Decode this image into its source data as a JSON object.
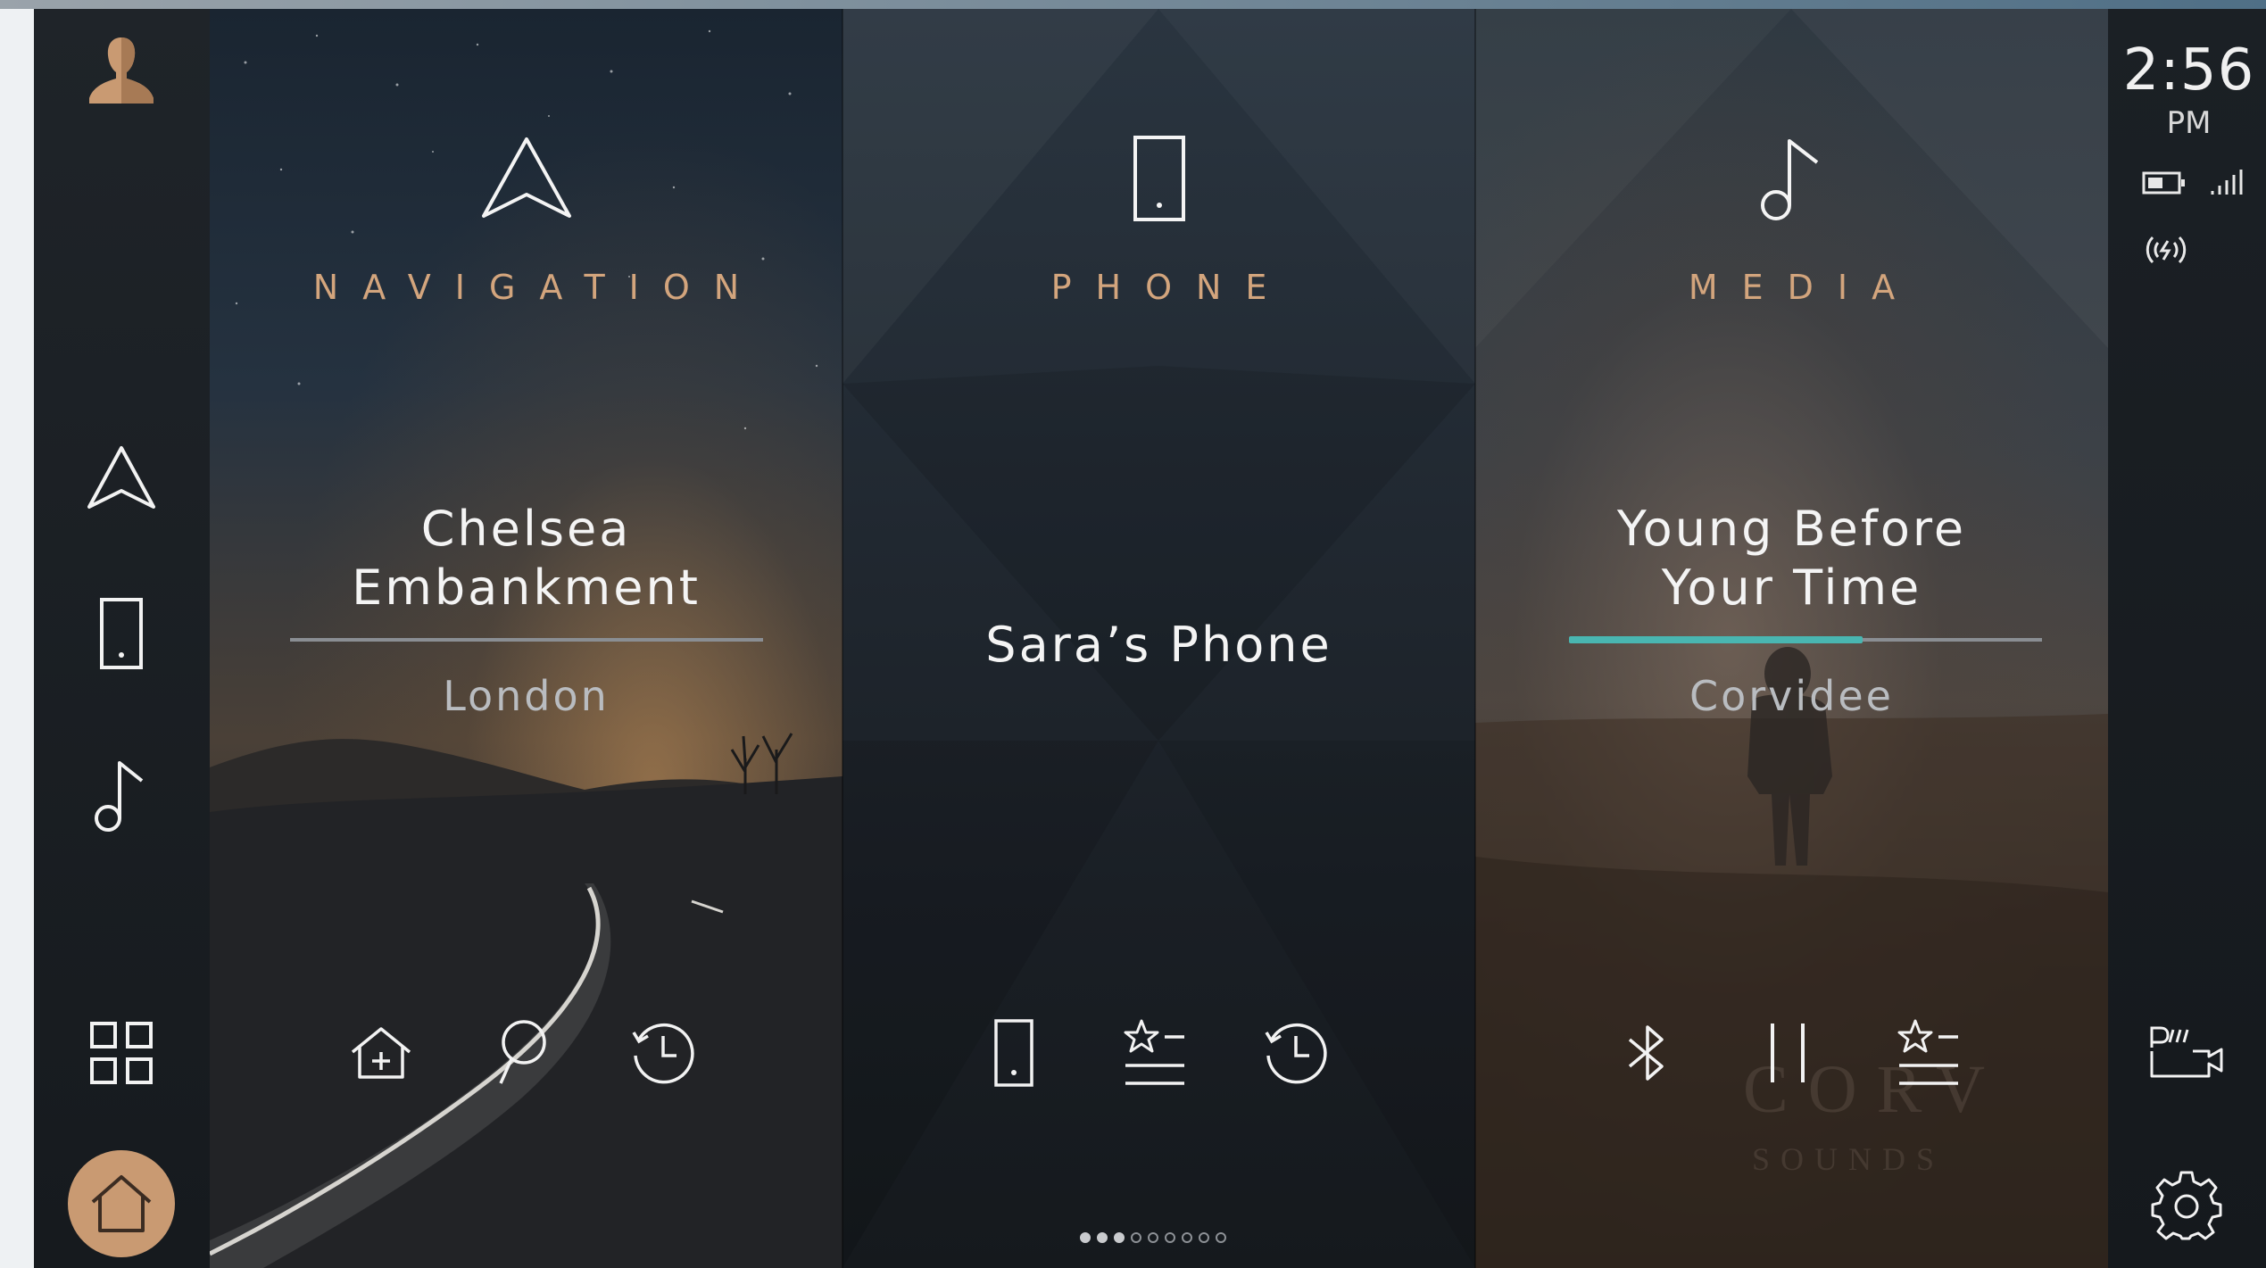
{
  "clock": {
    "time": "2:56",
    "ampm": "PM"
  },
  "panels": {
    "navigation": {
      "title": "NAVIGATION",
      "main": "Chelsea\nEmbankment",
      "sub": "London",
      "actions": [
        "home-add-icon",
        "search-icon",
        "recent-history-icon"
      ]
    },
    "phone": {
      "title": "PHONE",
      "main": "Sara’s Phone",
      "actions": [
        "phone-icon",
        "favourites-list-icon",
        "recent-history-icon"
      ]
    },
    "media": {
      "title": "MEDIA",
      "main": "Young Before\nYour Time",
      "sub": "Corvidee",
      "progress": 0.62,
      "watermark_big": "CORV",
      "watermark_small": "SOUNDS",
      "actions": [
        "bluetooth-icon",
        "pause-icon",
        "favourites-list-icon"
      ]
    }
  },
  "left_rail": [
    "user-avatar-icon",
    "navigation-icon",
    "phone-icon",
    "music-note-icon",
    "app-grid-icon",
    "home-icon"
  ],
  "right_rail": [
    "battery-icon",
    "signal-icon",
    "wireless-charging-icon",
    "parking-camera-icon",
    "settings-gear-icon"
  ],
  "pagination": {
    "count": 9,
    "active": [
      0,
      1,
      2
    ]
  },
  "colors": {
    "accent": "#d3a57d",
    "progress": "#49b6b1",
    "home_button": "#c99a72"
  }
}
